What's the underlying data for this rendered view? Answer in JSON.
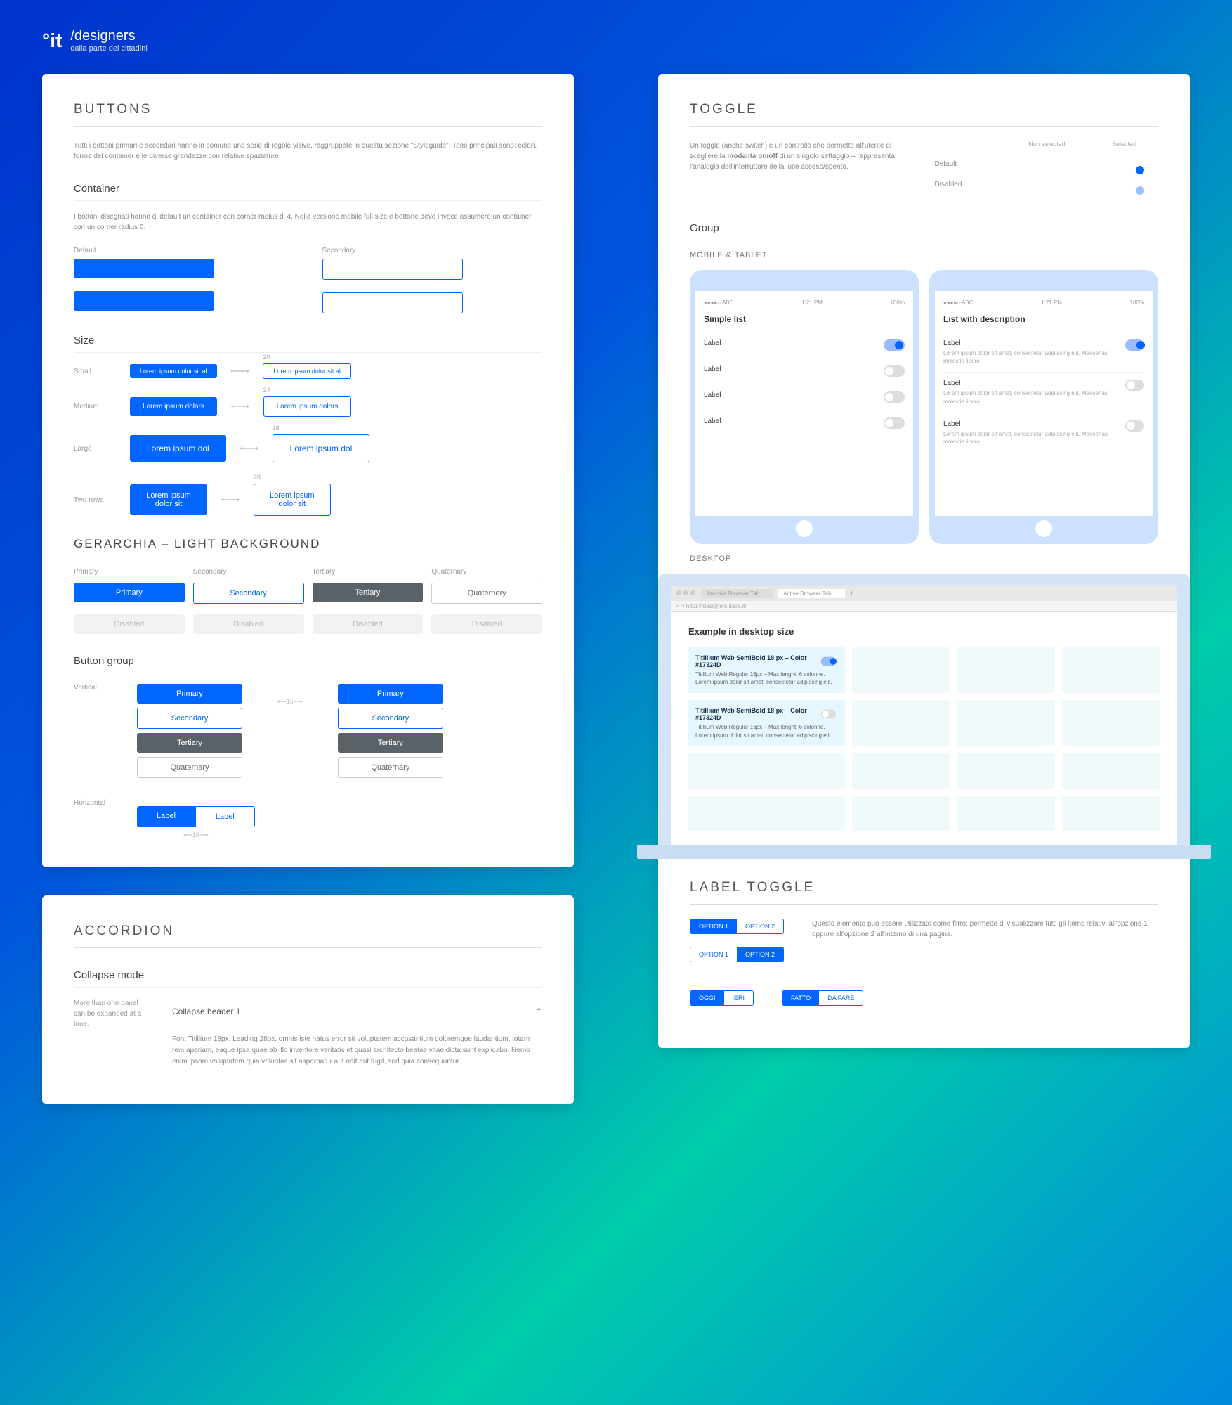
{
  "header": {
    "logo": "°it",
    "brand": "/designers",
    "tagline": "dalla parte dei cittadini"
  },
  "buttons": {
    "title": "BUTTONS",
    "intro": "Tutti i bottoni primari e secondari hanno in comune una serie di regole visive, raggruppate in questa sezione \"Styleguide\". Temi principali sono: colori, forma del container e le diverse grandezze con relative spaziature.",
    "container": {
      "title": "Container",
      "desc": "I bottoni disegnati hanno di default un container con corner radius di 4. Nella versione mobile full size è bottone deve invece assumere un container con un corner radius 0.",
      "default": "Default",
      "secondary": "Secondary"
    },
    "size": {
      "title": "Size",
      "rows": [
        {
          "label": "Small",
          "text": "Lorem ipsum dolor sit al",
          "m": "20"
        },
        {
          "label": "Medium",
          "text": "Lorem ipsum dolors",
          "m": "24"
        },
        {
          "label": "Large",
          "text": "Lorem ipsum dol",
          "m": "28"
        },
        {
          "label": "Two rows",
          "text": "Lorem ipsum dolor sit",
          "m": "28"
        }
      ]
    },
    "hierarchy": {
      "title": "GERARCHIA – LIGHT BACKGROUND",
      "cols": [
        "Primary",
        "Secondary",
        "Tertiary",
        "Quaternary"
      ],
      "btns": [
        "Primary",
        "Secondary",
        "Tertiary",
        "Quaternery"
      ],
      "disabled": "Disabled"
    },
    "group": {
      "title": "Button group",
      "vertical": "Vertical",
      "horizontal": "Horizontal",
      "labels": [
        "Primary",
        "Secondary",
        "Tertiary",
        "Quaternary"
      ],
      "hlabel": "Label",
      "gap": "16"
    }
  },
  "accordion": {
    "title": "ACCORDION",
    "mode": "Collapse mode",
    "note": "More than one panel can be expanded at a time.",
    "header": "Collapse header 1",
    "body": "Font Titillium 18px. Leading 28px. omnis iste natus error sit voluptatem accusantium doloremque laudantium, totam rem aperiam, eaque ipsa quae ab illo inventore veritatis et quasi architecto beatae vitae dicta sunt explicabo. Nemo enim ipsam voluptatem quia voluptas sit aspernatur aut odit aut fugit, sed quia consequuntur"
  },
  "toggle": {
    "title": "TOGGLE",
    "intro": "Un toggle (anche switch) è un controllo che permette all'utente di scegliere la <b>modalità on/off</b> di un singolo settaggio – rappresenta l'analogia dell'interruttore della luce acceso/spento.",
    "cols": [
      "Non selected",
      "Selected"
    ],
    "rows": [
      "Default",
      "Disabled"
    ],
    "group": {
      "title": "Group",
      "mobile": "MOBILE & TABLET",
      "desktop": "DESKTOP"
    },
    "phone": {
      "time": "1:21 PM",
      "bat": "100%",
      "carrier": "●●●●○  ABC",
      "s1": "Simple list",
      "s2": "List with description",
      "label": "Label",
      "desc": "Lorem ipsum dolor sit amet, consectetur adipiscing elit. Maecenas molestie libero"
    },
    "laptop": {
      "tab1": "Inactive Browser Tab",
      "tab2": "Active Browser Tab",
      "url": "https://designers.italia.it/",
      "title": "Example in desktop size",
      "card_h": "Titillium Web SemiBold 18 px – Color #17324D",
      "card_s": "Titillium Web Regular 16px – Max lenght: 6 colonne. Lorem ipsum dolor sit amet, consectetur adipiscing elit."
    }
  },
  "labeltoggle": {
    "title": "LABEL TOGGLE",
    "opts": [
      "OPTION 1",
      "OPTION 2"
    ],
    "desc": "Questo elemento può essere utilizzato come filtro: permette di visualizzare tutti gli items relativi all'opzione 1 oppure all'opzione 2 all'interno di una pagina.",
    "pair1": [
      "OGGI",
      "IERI"
    ],
    "pair2": [
      "FATTO",
      "DA FARE"
    ]
  }
}
